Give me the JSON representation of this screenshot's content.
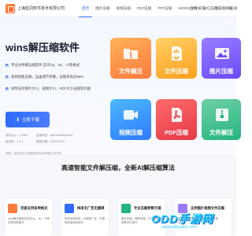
{
  "header": {
    "company": "上海蓝羽软件技术有限公司",
    "nav": [
      "首页",
      "图片压缩",
      "视频压缩",
      "PDF压缩",
      "PPT压缩",
      "WORD压缩",
      "微信压缩",
      "GIF压缩"
    ],
    "active": "首页",
    "right": [
      "文件解压",
      "电脑版下载"
    ]
  },
  "hero": {
    "title": "wins解压缩软件",
    "features": [
      "专业文件解压缩软件,支持zip、rar、7z等格式",
      "高效智能压缩，自由调节参数，压缩率高达98%",
      "同时支持图片大小、视频大小、PDF大小压缩等功能"
    ],
    "download_label": "立即下载",
    "meta": {
      "size": "软件大小：2.05M",
      "version": "版本号：1.1.1",
      "platform": "适用系统：Win7/Win8/Win10",
      "date": "更新日期：2024-05-02"
    },
    "note": "说明：该软件由上海蓝羽软件技术有限公司开发"
  },
  "tiles": [
    {
      "label": "文件解压",
      "icon": "folder-zip-icon"
    },
    {
      "label": "文件压缩",
      "icon": "file-compress-icon"
    },
    {
      "label": "图片压缩",
      "icon": "image-icon"
    },
    {
      "label": "视频压缩",
      "icon": "video-icon"
    },
    {
      "label": "PDF压缩",
      "icon": "pdf-icon"
    },
    {
      "label": "文件解压",
      "icon": "archive-icon"
    }
  ],
  "section": {
    "title": "高速智能文件解压缩，全新AI解压缩算法",
    "cards": [
      {
        "title": "完美支持多种格式",
        "desc": "wins解压缩软件支持zip、rar、7z等多种常用格式",
        "color": "#ff7a3d"
      },
      {
        "title": "纯净无广告无捆绑",
        "desc": "软件纯净绿色，无弹窗广告，不捆绑安装其他软件",
        "color": "#2f6bff"
      },
      {
        "title": "专业压缩参数可调",
        "desc": "图片压缩、视频压缩、PDF压缩等参数均可调节",
        "color": "#24b47e"
      },
      {
        "title": "支持图片视频文件压缩",
        "desc": "多种文件类型批量压缩，节省存储空间",
        "color": "#9a7bff"
      }
    ]
  },
  "watermark": {
    "main": "ODD手游网",
    "sub": "www.oddgame.com"
  }
}
